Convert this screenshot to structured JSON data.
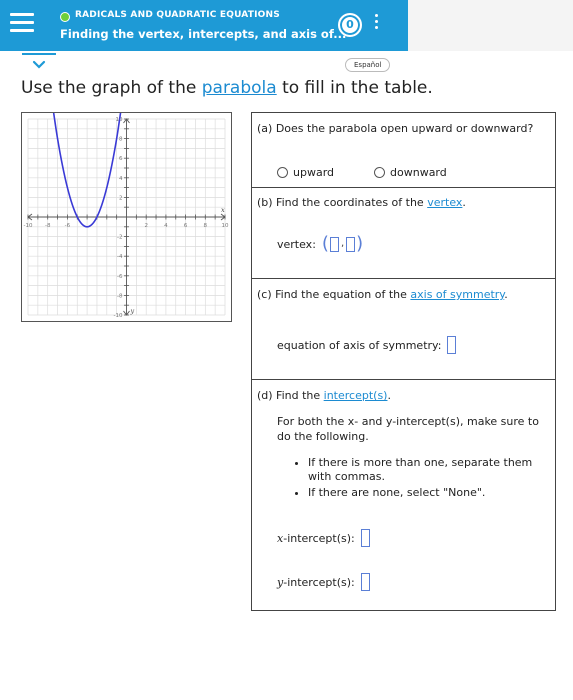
{
  "header": {
    "topic": "RADICALS AND QUADRATIC EQUATIONS",
    "lesson": "Finding the vertex, intercepts, and axis of...",
    "progress_count": "0"
  },
  "language_button": "Español",
  "instruction": {
    "prefix": "Use the graph of the ",
    "link": "parabola",
    "suffix": " to fill in the table."
  },
  "graph": {
    "x_axis_label": "x",
    "y_axis_label": "y",
    "x_tick_labels": [
      "-10",
      "-8",
      "-6",
      "2",
      "4",
      "6",
      "8",
      "10"
    ],
    "y_tick_labels": [
      "10",
      "8",
      "6",
      "4",
      "2",
      "-2",
      "-4",
      "-6",
      "-8",
      "-10"
    ],
    "xlim": [
      -10,
      10
    ],
    "ylim": [
      -10,
      10
    ],
    "curve_color": "#3a3ad6",
    "vertex": [
      -4,
      -1
    ],
    "points": [
      [
        -8,
        15
      ],
      [
        -7,
        8
      ],
      [
        -6,
        3
      ],
      [
        -5,
        0
      ],
      [
        -4,
        -1
      ],
      [
        -3,
        0
      ],
      [
        -2,
        3
      ],
      [
        -1,
        8
      ],
      [
        0,
        15
      ]
    ]
  },
  "table": {
    "a": {
      "question": "(a) Does the parabola open upward or downward?",
      "option_up": "upward",
      "option_down": "downward"
    },
    "b": {
      "prefix": "(b) Find the coordinates of the ",
      "link": "vertex",
      "suffix": ".",
      "field_label": "vertex:",
      "comma": ","
    },
    "c": {
      "prefix": "(c) Find the equation of the ",
      "link": "axis of symmetry",
      "suffix": ".",
      "field_label": "equation of axis of symmetry:"
    },
    "d": {
      "prefix": "(d) Find the ",
      "link": "intercept(s)",
      "suffix": ".",
      "instructions": "For both the x- and y-intercept(s), make sure to do the following.",
      "bullets": [
        "If there is more than one, separate them with commas.",
        "If there are none, select \"None\"."
      ],
      "x_label_var": "x",
      "x_label_rest": "-intercept(s):",
      "y_label_var": "y",
      "y_label_rest": "-intercept(s):"
    }
  },
  "colors": {
    "header_blue": "#1e9ad6",
    "link_blue": "#1c8bd1",
    "input_border": "#5b7fd6",
    "topic_dot": "#6fcf3a"
  }
}
